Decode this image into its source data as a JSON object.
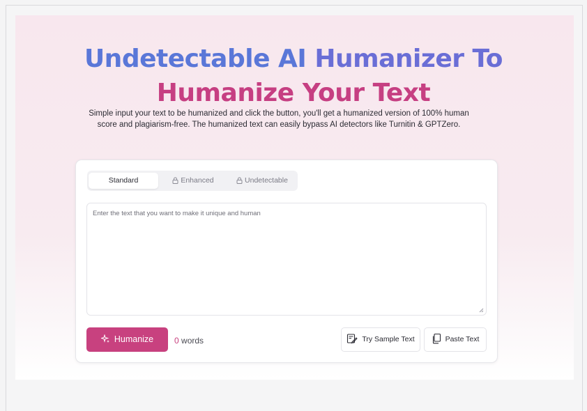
{
  "hero": {
    "title_line1_a": "Undetectable AI ",
    "title_line1_b": "Humanizer To",
    "title_line2": "Humanize Your Text",
    "subtitle_line1": "Simple input your text to be humanized and click the button, you'll get a humanized version of 100% human",
    "subtitle_line2": "score and plagiarism-free. The humanized text can easily bypass AI detectors like Turnitin & GPTZero."
  },
  "tabs": [
    {
      "label": "Standard",
      "active": true,
      "locked": false
    },
    {
      "label": "Enhanced",
      "active": false,
      "locked": true
    },
    {
      "label": "Undetectable",
      "active": false,
      "locked": true
    }
  ],
  "editor": {
    "placeholder": "Enter the text that you want to make it unique and human",
    "value": ""
  },
  "actions": {
    "humanize_label": "Humanize",
    "word_count": "0",
    "word_unit": " words",
    "sample_label": "Try Sample Text",
    "paste_label": "Paste Text"
  },
  "colors": {
    "accent": "#c8417f",
    "title_blue": "#5a77d8",
    "title_pink": "#c63f82"
  },
  "icons": [
    "lock-icon",
    "sparkle-icon",
    "sample-text-icon",
    "paste-icon",
    "resize-handle-icon"
  ]
}
